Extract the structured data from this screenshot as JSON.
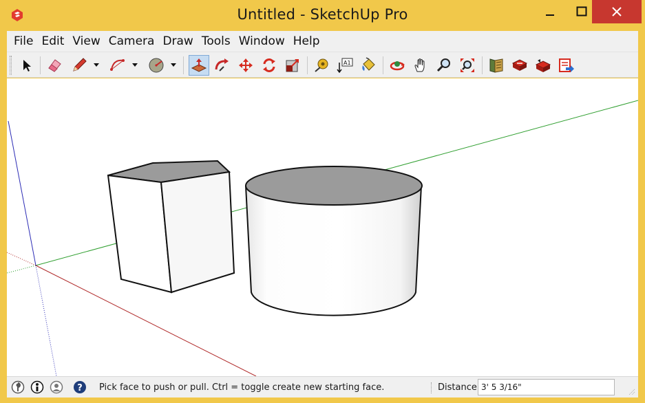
{
  "window": {
    "title": "Untitled - SketchUp Pro",
    "controls": [
      "minimize",
      "maximize",
      "close"
    ]
  },
  "menu": {
    "items": [
      "File",
      "Edit",
      "View",
      "Camera",
      "Draw",
      "Tools",
      "Window",
      "Help"
    ]
  },
  "toolbar": {
    "tools": [
      {
        "name": "select-tool",
        "icon": "arrow-pointer-icon"
      },
      {
        "name": "eraser-tool",
        "icon": "eraser-icon"
      },
      {
        "name": "line-tool",
        "icon": "pencil-icon"
      },
      {
        "name": "arc-tool",
        "icon": "arc-icon"
      },
      {
        "name": "circle-tool",
        "icon": "circle-icon"
      },
      {
        "name": "push-pull-tool",
        "icon": "push-pull-icon",
        "active": true
      },
      {
        "name": "follow-me-tool",
        "icon": "follow-me-icon"
      },
      {
        "name": "move-tool",
        "icon": "move-arrows-icon"
      },
      {
        "name": "rotate-tool",
        "icon": "rotate-icon"
      },
      {
        "name": "scale-tool",
        "icon": "scale-icon"
      },
      {
        "name": "tape-measure-tool",
        "icon": "tape-measure-icon"
      },
      {
        "name": "text-tool",
        "icon": "text-A1-icon"
      },
      {
        "name": "paint-bucket-tool",
        "icon": "paint-bucket-icon"
      },
      {
        "name": "orbit-tool",
        "icon": "orbit-icon"
      },
      {
        "name": "pan-tool",
        "icon": "hand-icon"
      },
      {
        "name": "zoom-tool",
        "icon": "magnifier-icon"
      },
      {
        "name": "zoom-extents-tool",
        "icon": "zoom-extents-icon"
      },
      {
        "name": "3d-warehouse-tool",
        "icon": "warehouse-icon"
      },
      {
        "name": "share-model-tool",
        "icon": "share-model-icon"
      },
      {
        "name": "get-models-tool",
        "icon": "get-models-icon"
      },
      {
        "name": "extension-warehouse-tool",
        "icon": "extension-icon"
      }
    ],
    "text_tool_label": "A1"
  },
  "status": {
    "hint": "Pick face to push or pull.  Ctrl = toggle create new starting face.",
    "measure_label": "Distance",
    "measure_value": "3' 5 3/16\""
  },
  "colors": {
    "frame": "#f1c84a",
    "close_button": "#c7372f",
    "red_axis": "#c0392b",
    "green_axis": "#2e9e2e",
    "blue_axis": "#2b2bb5",
    "top_face": "#9a9a9a"
  }
}
